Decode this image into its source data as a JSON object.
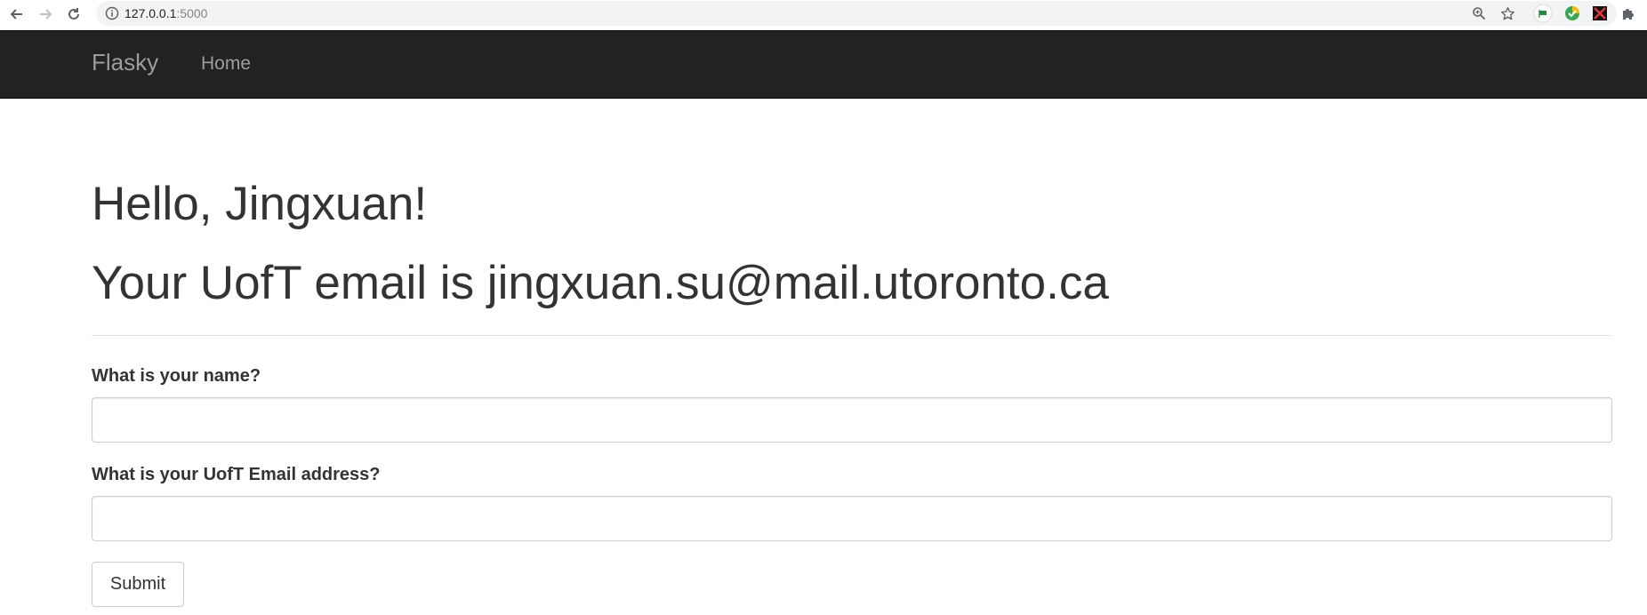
{
  "browser": {
    "url_host": "127.0.0.1",
    "url_port": ":5000",
    "icons": [
      "back-arrow-icon",
      "forward-arrow-icon",
      "reload-icon",
      "info-icon",
      "zoom-icon",
      "star-icon",
      "extension-green-flag-icon",
      "extension-check-icon",
      "extension-x-icon",
      "puzzle-icon"
    ]
  },
  "navbar": {
    "brand": "Flasky",
    "links": [
      {
        "label": "Home"
      }
    ],
    "background": "#222222",
    "text_color": "#9d9d9d"
  },
  "main": {
    "greeting": "Hello, Jingxuan!",
    "email_line": "Your UofT email is jingxuan.su@mail.utoronto.ca"
  },
  "form": {
    "name_label": "What is your name?",
    "name_value": "",
    "email_label": "What is your UofT Email address?",
    "email_value": "",
    "submit_label": "Submit"
  }
}
